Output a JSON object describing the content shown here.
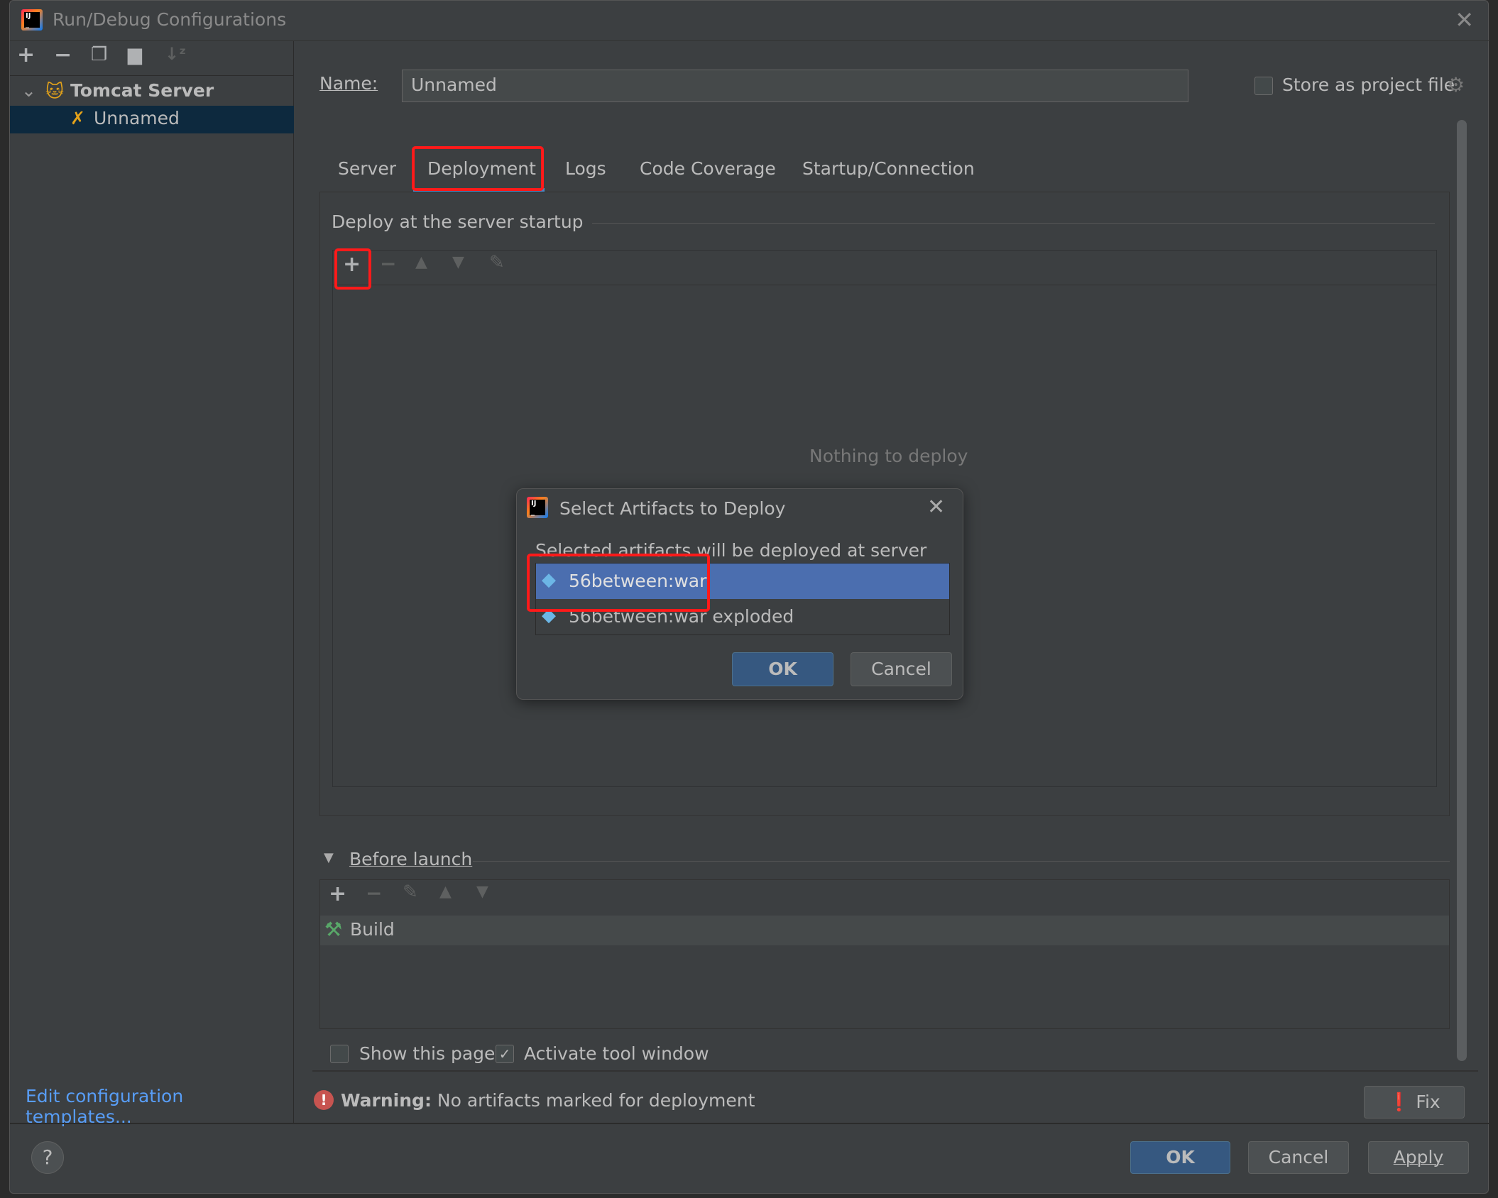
{
  "window": {
    "title": "Run/Debug Configurations"
  },
  "toolbar": {
    "icons": [
      "plus-icon",
      "minus-icon",
      "copy-icon",
      "folder-add-icon",
      "sort-alpha-icon"
    ]
  },
  "tree": {
    "group": "Tomcat Server",
    "item": "Unnamed"
  },
  "form": {
    "name_label": "Name:",
    "name_value": "Unnamed",
    "store_label": "Store as project file",
    "store_checked": false
  },
  "tabs": [
    {
      "label": "Server"
    },
    {
      "label": "Deployment",
      "active": true
    },
    {
      "label": "Logs"
    },
    {
      "label": "Code Coverage"
    },
    {
      "label": "Startup/Connection"
    }
  ],
  "deploy": {
    "section": "Deploy at the server startup",
    "empty": "Nothing to deploy"
  },
  "before_launch": {
    "label": "Before launch",
    "items": [
      "Build"
    ]
  },
  "options": {
    "show_page": "Show this page",
    "show_page_checked": false,
    "activate": "Activate tool window",
    "activate_checked": true
  },
  "warning": {
    "bold": "Warning:",
    "text": "No artifacts marked for deployment",
    "fix": "Fix"
  },
  "left_link": "Edit configuration templates...",
  "footer": {
    "help": "?",
    "ok": "OK",
    "cancel": "Cancel",
    "apply": "Apply"
  },
  "popup": {
    "title": "Select Artifacts to Deploy",
    "description": "Selected artifacts will be deployed at server startup",
    "items": [
      "56between:war",
      "56between:war exploded"
    ],
    "selected": 0,
    "ok": "OK",
    "cancel": "Cancel"
  },
  "colors": {
    "accent": "#365880",
    "selection": "#4b6eaf",
    "highlight": "#ff1a1a",
    "link": "#589df6"
  }
}
